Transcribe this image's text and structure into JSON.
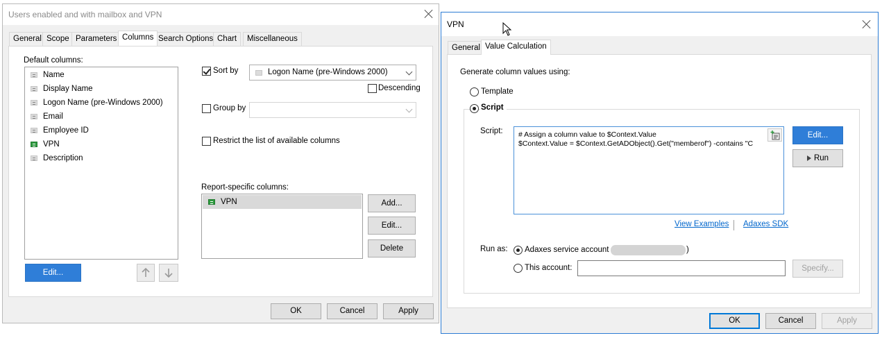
{
  "left_window": {
    "title": "Users enabled and with mailbox and VPN",
    "tabs": [
      "General",
      "Scope",
      "Parameters",
      "Columns",
      "Search Options",
      "Chart",
      "Miscellaneous"
    ],
    "active_tab": "Columns",
    "default_columns_label": "Default columns:",
    "default_columns": [
      "Name",
      "Display Name",
      "Logon Name (pre-Windows 2000)",
      "Email",
      "Employee ID",
      "VPN",
      "Description"
    ],
    "edit_button": "Edit...",
    "sort_by_label": "Sort by",
    "sort_by_value": "Logon Name (pre-Windows 2000)",
    "descending_label": "Descending",
    "group_by_label": "Group by",
    "restrict_label": "Restrict the list of available columns",
    "report_specific_label": "Report-specific columns:",
    "report_specific_columns": [
      "VPN"
    ],
    "add_button": "Add...",
    "edit_button2": "Edit...",
    "delete_button": "Delete",
    "ok_button": "OK",
    "cancel_button": "Cancel",
    "apply_button": "Apply"
  },
  "right_window": {
    "title": "VPN",
    "tabs": [
      "General",
      "Value Calculation"
    ],
    "active_tab": "Value Calculation",
    "generate_label": "Generate column values using:",
    "template_label": "Template",
    "script_label": "Script",
    "script_field_label": "Script:",
    "script_lines": [
      "# Assign a column value to $Context.Value",
      "$Context.Value = $Context.GetADObject().Get(\"memberof\") -contains \"C"
    ],
    "edit_button": "Edit...",
    "run_button": "Run",
    "view_examples_link": "View Examples",
    "sdk_link": "Adaxes SDK",
    "run_as_label": "Run as:",
    "service_account_label": "Adaxes service account (",
    "service_account_close": ")",
    "this_account_label": "This account:",
    "specify_button": "Specify...",
    "ok_button": "OK",
    "cancel_button": "Cancel",
    "apply_button": "Apply"
  },
  "colors": {
    "accent": "#2f7ed8",
    "focus": "#0078d7",
    "link": "#0066cc",
    "vpn_icon": "#2e9a3f"
  }
}
